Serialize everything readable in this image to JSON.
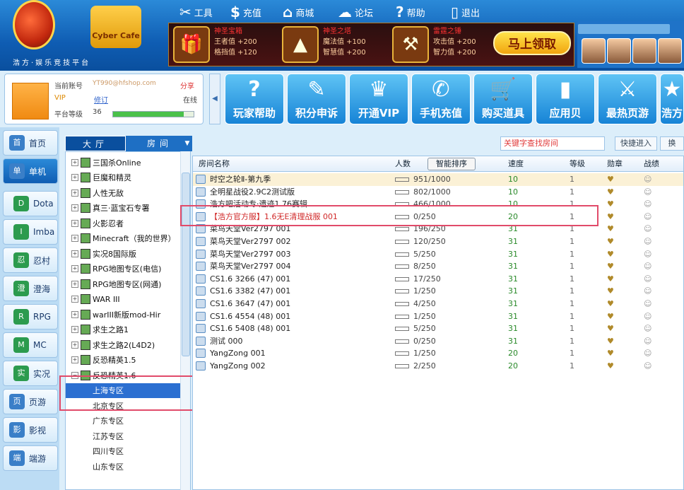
{
  "brand": {
    "slogan": "浩方·娱乐竞技平台",
    "cafe_label": "Cyber Cafe"
  },
  "topnav": [
    {
      "icon": "tools-icon",
      "glyph": "✂",
      "label": "工具"
    },
    {
      "icon": "money-icon",
      "glyph": "$",
      "label": "充值"
    },
    {
      "icon": "shop-icon",
      "glyph": "⌂",
      "label": "商城"
    },
    {
      "icon": "chat-icon",
      "glyph": "☁",
      "label": "论坛"
    },
    {
      "icon": "help-icon",
      "glyph": "?",
      "label": "帮助"
    },
    {
      "icon": "exit-icon",
      "glyph": "▯",
      "label": "退出"
    }
  ],
  "ad": {
    "items": [
      {
        "title": "神圣宝箱",
        "line1": "王者值 +200",
        "line2": "格挡值 +120",
        "glyph": "🎁"
      },
      {
        "title": "神圣之塔",
        "line1": "魔法值 +100",
        "line2": "智慧值 +200",
        "glyph": "▲"
      },
      {
        "title": "雷霆之锤",
        "line1": "攻击值 +200",
        "line2": "智力值 +200",
        "glyph": "⚒"
      }
    ],
    "claim": "马上领取"
  },
  "user": {
    "account_label": "当前账号",
    "account_value": "YT990@hfshop.com",
    "share": "分享",
    "vip": "VIP",
    "fix": "修订",
    "status": "在线",
    "level_label": "平台等级",
    "level_value": "36",
    "level_progress": 0.88
  },
  "tiles": [
    {
      "label": "玩家帮助",
      "glyph": "?"
    },
    {
      "label": "积分申诉",
      "glyph": "✎"
    },
    {
      "label": "开通VIP",
      "glyph": "♛"
    },
    {
      "label": "手机充值",
      "glyph": "✆"
    },
    {
      "label": "购买道具",
      "glyph": "🛒"
    },
    {
      "label": "应用贝",
      "glyph": "▮"
    },
    {
      "label": "最热页游",
      "glyph": "⚔"
    },
    {
      "label": "浩方",
      "glyph": "★"
    }
  ],
  "sidenav": [
    {
      "label": "首页",
      "icon": "home-icon",
      "active": false
    },
    {
      "label": "单机",
      "icon": "pc-icon",
      "active": true
    },
    {
      "label": "Dota",
      "icon": "dota-icon",
      "sub": true
    },
    {
      "label": "Imba",
      "icon": "imba-icon",
      "sub": true
    },
    {
      "label": "忍村",
      "icon": "ninja-icon",
      "sub": true
    },
    {
      "label": "澄海",
      "icon": "sea-icon",
      "sub": true
    },
    {
      "label": "RPG",
      "icon": "rpg-icon",
      "sub": true
    },
    {
      "label": "MC",
      "icon": "mc-icon",
      "sub": true
    },
    {
      "label": "实况",
      "icon": "soccer-icon",
      "sub": true
    },
    {
      "label": "页游",
      "icon": "webgame-icon",
      "active": false
    },
    {
      "label": "影视",
      "icon": "video-icon",
      "active": false
    },
    {
      "label": "端游",
      "icon": "client-icon",
      "active": false
    }
  ],
  "tabs": {
    "hall": "大厅",
    "room": "房间"
  },
  "tree": [
    {
      "label": "三国杀Online"
    },
    {
      "label": "巨魔和精灵"
    },
    {
      "label": "人性无敌"
    },
    {
      "label": "真三·蓝宝石专署"
    },
    {
      "label": "火影忍者"
    },
    {
      "label": "Minecraft（我的世界）"
    },
    {
      "label": "实况8国际版"
    },
    {
      "label": "RPG地图专区(电信)"
    },
    {
      "label": "RPG地图专区(网通)"
    },
    {
      "label": "WAR III"
    },
    {
      "label": "warIII新版mod-Hir"
    },
    {
      "label": "求生之路1"
    },
    {
      "label": "求生之路2(L4D2)"
    },
    {
      "label": "反恐精英1.5"
    },
    {
      "label": "反恐精英1.6"
    }
  ],
  "tree_children": [
    "上海专区",
    "北京专区",
    "广东专区",
    "江苏专区",
    "四川专区",
    "山东专区"
  ],
  "search": {
    "placeholder": "关键字查找房间",
    "quick": "快捷进入",
    "other": "换"
  },
  "list": {
    "headers": {
      "name": "房间名称",
      "count": "人数",
      "sort": "智能排序",
      "speed": "速度",
      "level": "等级",
      "badge": "勋章",
      "war": "战绩"
    },
    "rows": [
      {
        "name": "时空之轮Ⅱ-第九季",
        "count": "951/1000",
        "speed": "10",
        "level": "1"
      },
      {
        "name": "全明星战役2.9C2测试版",
        "count": "802/1000",
        "speed": "10",
        "level": "1"
      },
      {
        "name": "浩方吧活动专·遗迹1.76赛辑",
        "count": "466/1000",
        "speed": "10",
        "level": "1"
      },
      {
        "name": "【浩方官方服】1.6无E清理战服 001",
        "count": "0/250",
        "speed": "20",
        "level": "1",
        "red": true
      },
      {
        "name": "菜鸟天堂Ver2797 001",
        "count": "196/250",
        "speed": "31",
        "level": "1"
      },
      {
        "name": "菜鸟天堂Ver2797 002",
        "count": "120/250",
        "speed": "31",
        "level": "1"
      },
      {
        "name": "菜鸟天堂Ver2797 003",
        "count": "5/250",
        "speed": "31",
        "level": "1"
      },
      {
        "name": "菜鸟天堂Ver2797 004",
        "count": "8/250",
        "speed": "31",
        "level": "1"
      },
      {
        "name": "CS1.6 3266 (47) 001",
        "count": "17/250",
        "speed": "31",
        "level": "1"
      },
      {
        "name": "CS1.6 3382 (47) 001",
        "count": "1/250",
        "speed": "31",
        "level": "1"
      },
      {
        "name": "CS1.6 3647 (47) 001",
        "count": "4/250",
        "speed": "31",
        "level": "1"
      },
      {
        "name": "CS1.6 4554 (48) 001",
        "count": "1/250",
        "speed": "31",
        "level": "1"
      },
      {
        "name": "CS1.6 5408 (48) 001",
        "count": "5/250",
        "speed": "31",
        "level": "1"
      },
      {
        "name": "测试 000",
        "count": "0/250",
        "speed": "31",
        "level": "1"
      },
      {
        "name": "YangZong 001",
        "count": "1/250",
        "speed": "20",
        "level": "1"
      },
      {
        "name": "YangZong 002",
        "count": "2/250",
        "speed": "20",
        "level": "1"
      }
    ]
  }
}
